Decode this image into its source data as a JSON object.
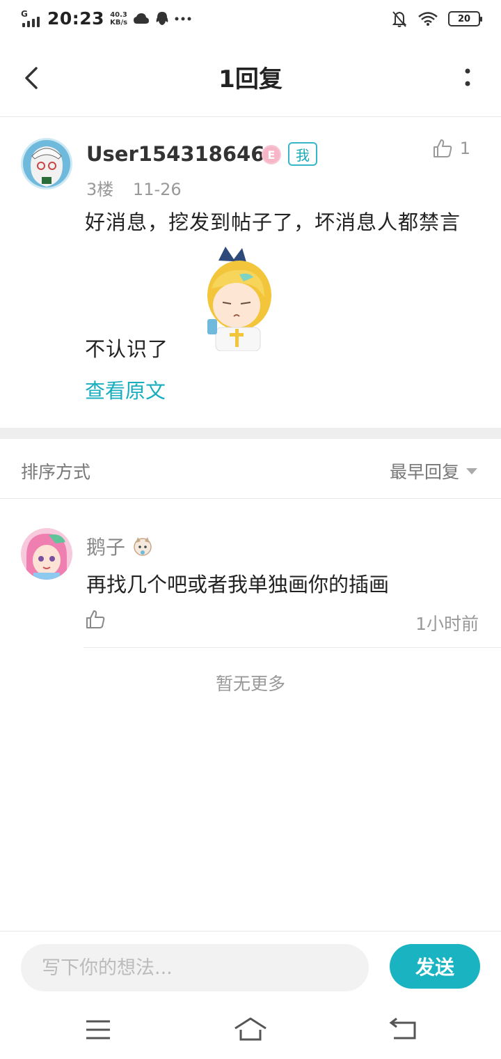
{
  "status_bar": {
    "network": "G",
    "time": "20:23",
    "speed_value": "40.3",
    "speed_unit": "KB/s",
    "battery": "20"
  },
  "header": {
    "title": "1回复"
  },
  "post": {
    "username": "User1543186466",
    "level_badge": "E",
    "me_badge": "我",
    "floor": "3楼",
    "date": "11-26",
    "like_count": "1",
    "text_line1": "好消息，挖发到帖子了，坏消息人都禁言",
    "text_line2": "不认识了",
    "view_original": "查看原文"
  },
  "sort": {
    "label": "排序方式",
    "selected": "最早回复"
  },
  "reply": {
    "username": "鹅子",
    "text": "再找几个吧或者我单独画你的插画",
    "time": "1小时前"
  },
  "list_end": "暂无更多",
  "composer": {
    "placeholder": "写下你的想法...",
    "send_label": "发送"
  },
  "colors": {
    "accent": "#1ab3c1",
    "link": "#19aebf",
    "badge_pink": "#f6b6c8"
  },
  "icons": {
    "back": "chevron-left-icon",
    "more": "more-vertical-icon",
    "like": "thumbs-up-icon",
    "menu": "menu-icon",
    "home": "home-icon",
    "return": "back-arrow-icon"
  }
}
